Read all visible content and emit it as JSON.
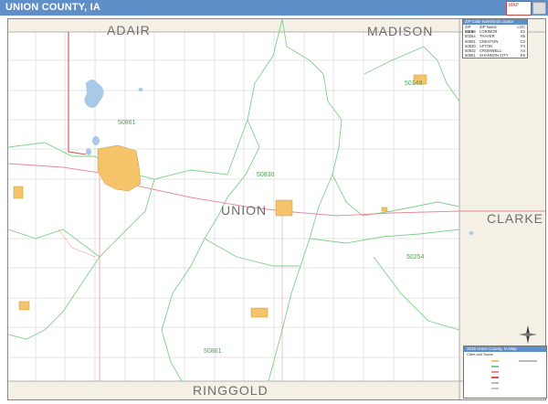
{
  "header": {
    "title": "UNION COUNTY, IA",
    "bar_color": "#5f8fc9"
  },
  "county_labels": {
    "adair": "ADAIR",
    "madison": "MADISON",
    "union": "UNION",
    "clarke": "CLARKE",
    "ringgold": "RINGGOLD"
  },
  "zip_labels": {
    "z1": "50149",
    "z2": "50861",
    "z3": "50830",
    "z4": "50254",
    "z5": "50861"
  },
  "zip_table": {
    "title": "ZIP Code Index/Grid Locator",
    "headers": [
      "ZIP Code",
      "ZIP Name",
      "LOC"
    ],
    "rows": [
      [
        "50149",
        "LORIMOR",
        "E2"
      ],
      [
        "50254",
        "THAYER",
        "H5"
      ],
      [
        "50801",
        "CRESTON",
        "C3"
      ],
      [
        "50830",
        "AFTON",
        "F4"
      ],
      [
        "50842",
        "CROMWELL",
        "A4"
      ],
      [
        "50861",
        "SHANNON CITY",
        "E6"
      ]
    ]
  },
  "legend": {
    "title": "2016 Union County, IA Map",
    "header_note": "Cities and Towns"
  },
  "colors": {
    "zip_boundary": "#7ed08a",
    "town_fill": "#f4c36a",
    "water": "#a9c9e8",
    "road": "#b8b8b8",
    "highway": "#e58a9a",
    "primary_road": "#d85050"
  }
}
